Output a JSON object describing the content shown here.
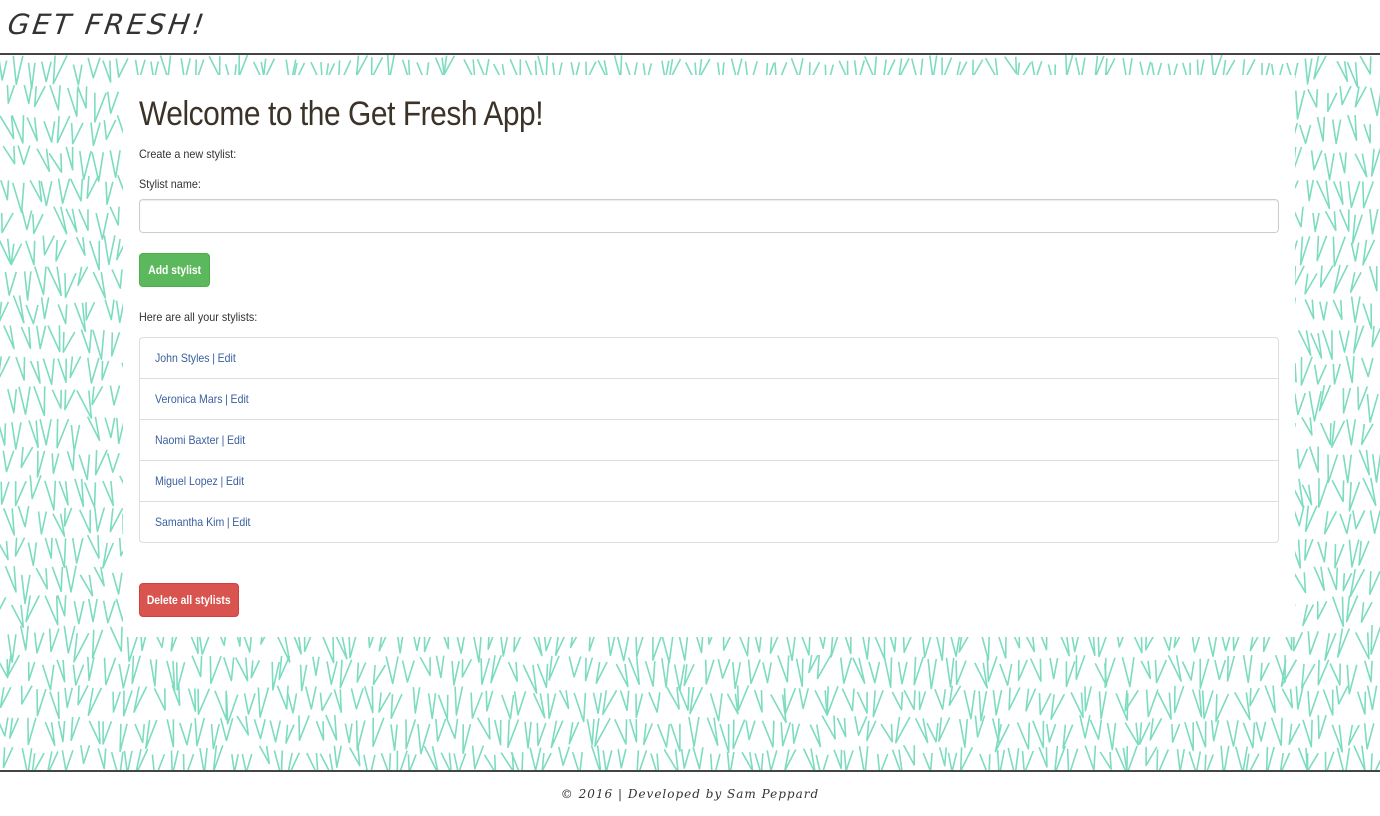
{
  "header": {
    "brand": "GET FRESH!"
  },
  "main": {
    "title": "Welcome to the Get Fresh App!",
    "create_label": "Create a new stylist:",
    "name_label": "Stylist name:",
    "name_input": {
      "value": "",
      "placeholder": ""
    },
    "add_button": "Add stylist",
    "list_label": "Here are all your stylists:",
    "stylists": [
      {
        "name": "John Styles",
        "sep": "|",
        "edit": "Edit"
      },
      {
        "name": "Veronica Mars",
        "sep": "|",
        "edit": "Edit"
      },
      {
        "name": "Naomi Baxter",
        "sep": "|",
        "edit": "Edit"
      },
      {
        "name": "Miguel Lopez",
        "sep": "|",
        "edit": "Edit"
      },
      {
        "name": "Samantha Kim",
        "sep": "|",
        "edit": "Edit"
      }
    ],
    "delete_button": "Delete all stylists"
  },
  "footer": {
    "text": "© 2016 | Developed by Sam Peppard"
  },
  "colors": {
    "pattern": "#7ddcc0",
    "add_button": "#5cb85c",
    "delete_button": "#d9534f",
    "link": "#3a5f9e"
  }
}
